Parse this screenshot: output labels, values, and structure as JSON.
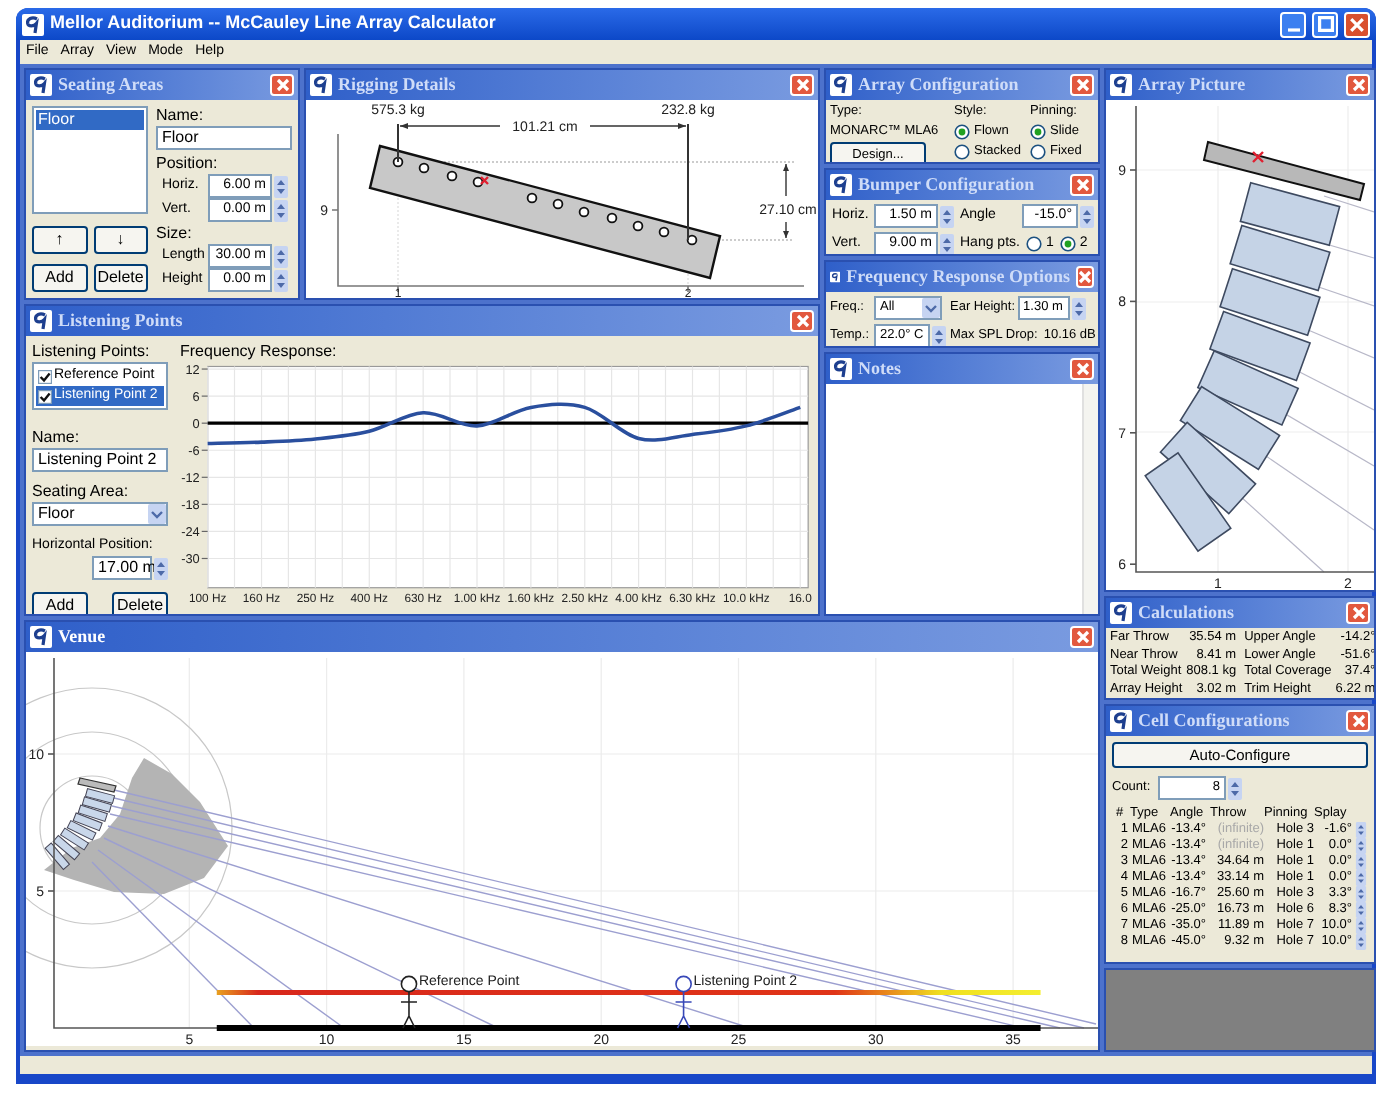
{
  "window": {
    "title": "Mellor Auditorium -- McCauley Line Array Calculator"
  },
  "menu": [
    "File",
    "Array",
    "View",
    "Mode",
    "Help"
  ],
  "seating_areas": {
    "title": "Seating Areas",
    "items": [
      {
        "label": "Floor",
        "selected": true
      }
    ],
    "name_label": "Name:",
    "name": "Floor",
    "position_label": "Position:",
    "position_fields": [
      {
        "label": "Horiz.",
        "value": "6.00 m"
      },
      {
        "label": "Vert.",
        "value": "0.00 m"
      }
    ],
    "size_label": "Size:",
    "size_fields": [
      {
        "label": "Length",
        "value": "30.00 m"
      },
      {
        "label": "Height",
        "value": "0.00 m"
      }
    ],
    "buttons": [
      "↑",
      "↓",
      "Add",
      "Delete"
    ]
  },
  "rigging_details": {
    "title": "Rigging Details",
    "loads": [
      "575.3 kg",
      "232.8 kg"
    ],
    "span": "101.21 cm",
    "drop": "27.10 cm",
    "yticks": [
      "9"
    ],
    "xticks": [
      "1",
      "2"
    ]
  },
  "listening_points": {
    "title": "Listening Points",
    "list_label": "Listening Points:",
    "items": [
      {
        "label": "Reference Point",
        "checked": true,
        "selected": false
      },
      {
        "label": "Listening Point 2",
        "checked": true,
        "selected": true
      }
    ],
    "name_label": "Name:",
    "name": "Listening Point 2",
    "seating_label": "Seating Area:",
    "seating": "Floor",
    "position_label": "Horizontal Position:",
    "position": "17.00 m",
    "buttons": [
      "Add",
      "Delete"
    ],
    "chart_label": "Frequency Response:",
    "chart_data": {
      "type": "line",
      "grid": true,
      "categories": [
        "100 Hz",
        "160 Hz",
        "250 Hz",
        "400 Hz",
        "630 Hz",
        "1.00 kHz",
        "1.60 kHz",
        "2.50 kHz",
        "4.00 kHz",
        "6.30 kHz",
        "10.0 kHz",
        "16.0"
      ],
      "yticks": [
        12,
        6,
        0,
        -6,
        -12,
        -18,
        -24,
        -30
      ],
      "ylim": [
        -36,
        12
      ],
      "series": [
        {
          "color": "#2a4f9e",
          "values": [
            -4.5,
            -4.2,
            -3.5,
            -1.8,
            2.3,
            -0.6,
            3.5,
            3.5,
            -3.4,
            -2.5,
            -0.6,
            3.5
          ]
        }
      ]
    }
  },
  "array_configuration": {
    "title": "Array Configuration",
    "type_label": "Type:",
    "type": "MONARC™ MLA6",
    "design_button": "Design...",
    "style_label": "Style:",
    "style_options": [
      {
        "label": "Flown",
        "selected": true
      },
      {
        "label": "Stacked",
        "selected": false
      }
    ],
    "pinning_label": "Pinning:",
    "pinning_options": [
      {
        "label": "Slide",
        "selected": true
      },
      {
        "label": "Fixed",
        "selected": false
      }
    ]
  },
  "bumper_configuration": {
    "title": "Bumper Configuration",
    "horiz_label": "Horiz.",
    "horiz": "1.50 m",
    "vert_label": "Vert.",
    "vert": "9.00 m",
    "angle_label": "Angle",
    "angle": "-15.0°",
    "hang_label": "Hang pts.",
    "hang_options": [
      {
        "label": "1",
        "selected": false
      },
      {
        "label": "2",
        "selected": true
      }
    ]
  },
  "frequency_response_options": {
    "title": "Frequency Response Options",
    "freq_label": "Freq.:",
    "freq": "All",
    "temp_label": "Temp.:",
    "temp": "22.0° C",
    "ear_label": "Ear Height:",
    "ear": "1.30 m",
    "spl_label": "Max SPL Drop:",
    "spl": "10.16 dB"
  },
  "notes": {
    "title": "Notes"
  },
  "array_picture": {
    "title": "Array Picture",
    "yticks": [
      "9",
      "8",
      "7",
      "6"
    ],
    "xticks": [
      "1",
      "2"
    ]
  },
  "calculations": {
    "title": "Calculations",
    "rows": [
      {
        "label": "Far Throw",
        "value": "35.54 m",
        "label_2": "Upper Angle",
        "value_2": "-14.2°"
      },
      {
        "label": "Near Throw",
        "value": "8.41 m",
        "label_2": "Lower Angle",
        "value_2": "-51.6°"
      },
      {
        "label": "Total Weight",
        "value": "808.1 kg",
        "label_2": "Total Coverage",
        "value_2": "37.4°"
      },
      {
        "label": "Array Height",
        "value": "3.02 m",
        "label_2": "Trim Height",
        "value_2": "6.22 m"
      }
    ]
  },
  "cell_configurations": {
    "title": "Cell Configurations",
    "auto_button": "Auto-Configure",
    "count_label": "Count:",
    "count": "8",
    "columns": [
      "#",
      "Type",
      "Angle",
      "Throw",
      "Pinning",
      "Splay"
    ],
    "rows": [
      {
        "number": "1",
        "type": "MLA6",
        "angle": "-13.4°",
        "throw": "(infinite)",
        "throw_muted": true,
        "pinning": "Hole 3",
        "splay": "-1.6°"
      },
      {
        "number": "2",
        "type": "MLA6",
        "angle": "-13.4°",
        "throw": "(infinite)",
        "throw_muted": true,
        "pinning": "Hole 1",
        "splay": "0.0°"
      },
      {
        "number": "3",
        "type": "MLA6",
        "angle": "-13.4°",
        "throw": "34.64 m",
        "throw_muted": false,
        "pinning": "Hole 1",
        "splay": "0.0°"
      },
      {
        "number": "4",
        "type": "MLA6",
        "angle": "-13.4°",
        "throw": "33.14 m",
        "throw_muted": false,
        "pinning": "Hole 1",
        "splay": "0.0°"
      },
      {
        "number": "5",
        "type": "MLA6",
        "angle": "-16.7°",
        "throw": "25.60 m",
        "throw_muted": false,
        "pinning": "Hole 3",
        "splay": "3.3°"
      },
      {
        "number": "6",
        "type": "MLA6",
        "angle": "-25.0°",
        "throw": "16.73 m",
        "throw_muted": false,
        "pinning": "Hole 6",
        "splay": "8.3°"
      },
      {
        "number": "7",
        "type": "MLA6",
        "angle": "-35.0°",
        "throw": "11.89 m",
        "throw_muted": false,
        "pinning": "Hole 7",
        "splay": "10.0°"
      },
      {
        "number": "8",
        "type": "MLA6",
        "angle": "-45.0°",
        "throw": "9.32 m",
        "throw_muted": false,
        "pinning": "Hole 7",
        "splay": "10.0°"
      }
    ]
  },
  "venue": {
    "title": "Venue",
    "yticks": [
      "10",
      "5"
    ],
    "xticks": [
      "5",
      "10",
      "15",
      "20",
      "25",
      "30",
      "35"
    ],
    "listeners": [
      {
        "label": "Reference Point",
        "selected": false
      },
      {
        "label": "Listening Point 2",
        "selected": true
      }
    ]
  }
}
